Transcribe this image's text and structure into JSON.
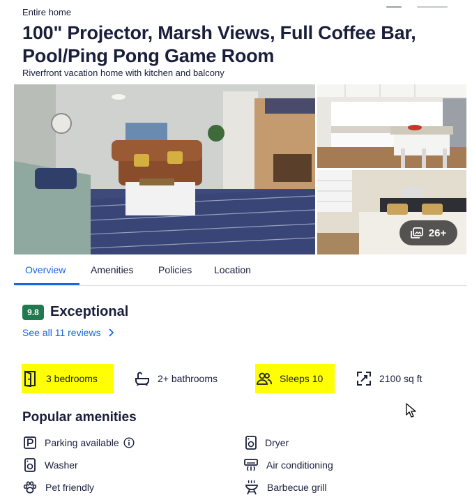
{
  "listing": {
    "type_label": "Entire home",
    "title": "100\" Projector, Marsh Views, Full Coffee Bar, Pool/Ping Pong Game Room",
    "subtitle": "Riverfront vacation home with kitchen and balcony"
  },
  "gallery": {
    "photo_count": "26+",
    "photos": [
      "living-room-photo",
      "kitchen-photo",
      "bedroom-photo"
    ]
  },
  "tabs": [
    {
      "label": "Overview",
      "active": true
    },
    {
      "label": "Amenities",
      "active": false
    },
    {
      "label": "Policies",
      "active": false
    },
    {
      "label": "Location",
      "active": false
    }
  ],
  "rating": {
    "score": "9.8",
    "label": "Exceptional",
    "reviews_link": "See all 11 reviews"
  },
  "facts": [
    {
      "label": "3 bedrooms",
      "icon": "door-icon",
      "highlighted": true
    },
    {
      "label": "2+ bathrooms",
      "icon": "bathtub-icon",
      "highlighted": false
    },
    {
      "label": "Sleeps 10",
      "icon": "people-icon",
      "highlighted": true
    },
    {
      "label": "2100 sq ft",
      "icon": "expand-icon",
      "highlighted": false
    }
  ],
  "amenities": {
    "title": "Popular amenities",
    "items": [
      {
        "label": "Parking available",
        "icon": "parking-icon",
        "info": true
      },
      {
        "label": "Dryer",
        "icon": "dryer-icon"
      },
      {
        "label": "Washer",
        "icon": "washer-icon"
      },
      {
        "label": "Air conditioning",
        "icon": "air-conditioning-icon"
      },
      {
        "label": "Pet friendly",
        "icon": "paw-icon"
      },
      {
        "label": "Barbecue grill",
        "icon": "grill-icon"
      }
    ]
  },
  "colors": {
    "accent": "#1668e3",
    "rating_badge": "#227950",
    "highlight": "#ffff00",
    "text": "#191e3b"
  }
}
